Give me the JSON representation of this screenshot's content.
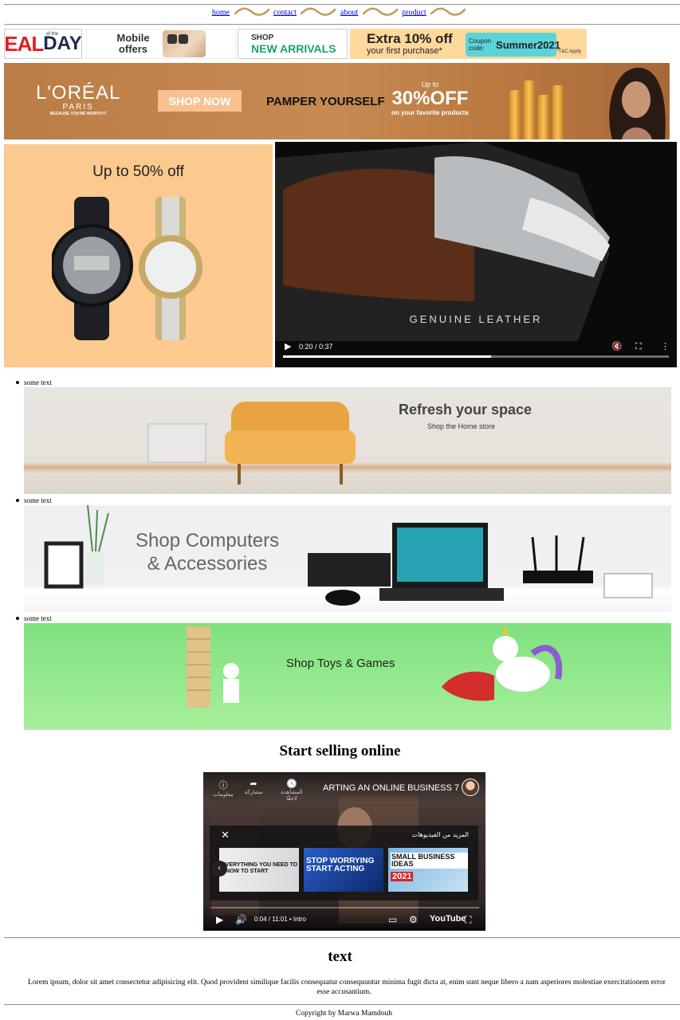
{
  "nav": {
    "links": [
      "home",
      "contact",
      "about",
      "product"
    ]
  },
  "promos": {
    "deal": {
      "big": "EAL",
      "day": "DAY",
      "ofthe": "of the"
    },
    "mobile": {
      "line1": "Mobile",
      "line2": "offers"
    },
    "arrivals": {
      "line1": "SHOP",
      "line2": "NEW ARRIVALS"
    },
    "coupon": {
      "line1": "Extra 10% off",
      "line2": "your first purchase*",
      "code_label": "Coupon code:",
      "code": "Summer2021",
      "tc": "*T&C Apply"
    }
  },
  "loreal": {
    "brand": "L'ORÉAL",
    "city": "PARIS",
    "tagline": "BECAUSE YOU'RE WORTH IT",
    "shop_now": "SHOP NOW",
    "pamper": "PAMPER YOURSELF",
    "upto": "Up to",
    "percent": "30%OFF",
    "favorite": "on your favorite products"
  },
  "watch_banner": {
    "title": "Up to 50% off"
  },
  "video1": {
    "caption": "GENUINE LEATHER",
    "time": "0:20 / 0:37",
    "progress": 0.54
  },
  "list": {
    "items": [
      {
        "label": "some text",
        "title": "Refresh your space",
        "subtitle": "Shop the Home store"
      },
      {
        "label": "some text",
        "title_line1": "Shop Computers",
        "title_line2": "& Accessories"
      },
      {
        "label": "some text",
        "title": "Shop Toys & Games"
      }
    ]
  },
  "selling": {
    "heading": "Start selling online",
    "video": {
      "title": "ARTING AN ONLINE BUSINESS 7",
      "icons": [
        "معلومات",
        "مشاركة",
        "المشاهدة لاحقًا"
      ],
      "more_title": "المزيد من الفيديوهات",
      "thumbs": [
        "EVERYTHING YOU NEED TO KNOW TO START",
        "STOP WORRYING START ACTING",
        "SMALL BUSINESS IDEAS"
      ],
      "thumb_year": "2021",
      "time": "0:04 / 11:01 • Intro",
      "logo": "YouTube"
    }
  },
  "footer": {
    "heading": "text",
    "lorem_line1": "Lorem ipsum, dolor sit amet consectetur adipisicing elit. Quod provident similique facilis consequatur consequuntur minima fugit dicta at, enim sunt neque libero a nam asperiores molestiae exercitationem error",
    "lorem_line2": "esse accusantium.",
    "copyright": "Copyright by Marwa Mamdouh"
  }
}
